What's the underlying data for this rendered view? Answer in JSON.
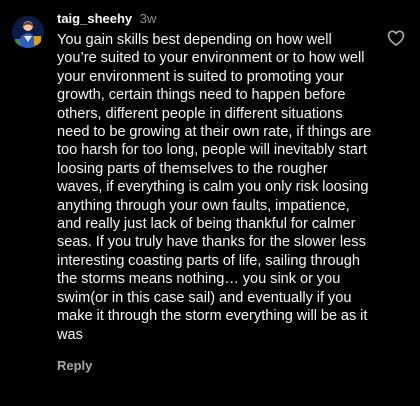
{
  "comment": {
    "username": "taig_sheehy",
    "time": "3w",
    "text": "You gain skills best depending on how well you’re suited to your environment or to how well your environment is suited to promoting your growth, certain things need to happen before others, different people in different situations need to be growing at their own rate, if things are too harsh for too long, people will inevitably start loosing parts of themselves to the rougher waves, if everything is calm you only risk loosing anything through your own faults, impatience, and really just lack of being thankful for calmer seas. If you truly have thanks for the slower less interesting coasting parts of life, sailing through the storms means nothing… you sink or you swim(or in this case sail) and eventually if you make it through the storm everything will be as it was",
    "reply_label": "Reply",
    "avatar_icon": "profile-avatar",
    "like_icon": "heart-outline-icon"
  },
  "colors": {
    "background": "#000000",
    "primary_text": "#f5f5f5",
    "secondary_text": "#8e8e8e",
    "reply_text": "#a8a8a8"
  }
}
